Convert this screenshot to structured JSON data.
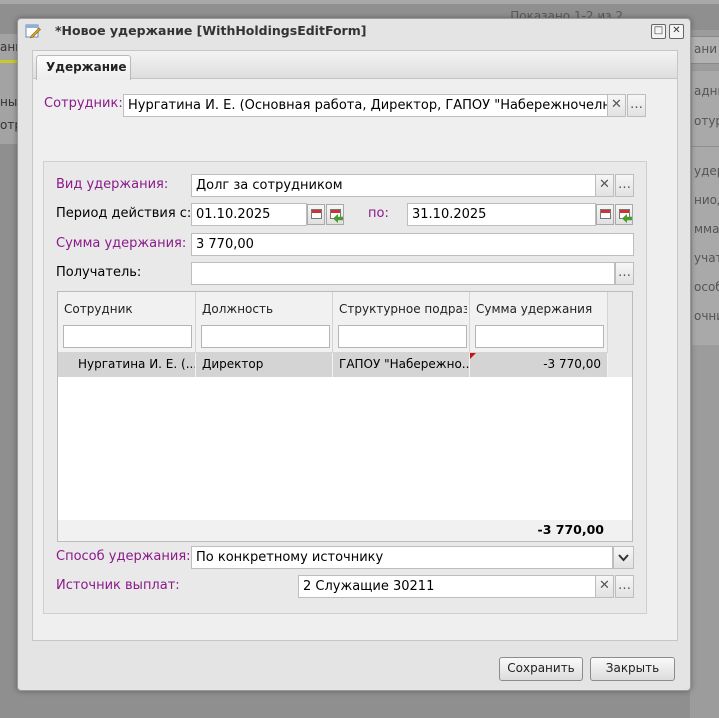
{
  "background": {
    "pager_text": "Показано 1-2 из 2",
    "left_tabs": [
      "ани",
      "ный",
      "отру"
    ],
    "right_items": [
      "адни",
      "отурн",
      "удер",
      "ниод Д",
      "мма уд",
      "учат",
      "особ у",
      "очни"
    ],
    "right_tab": "ани"
  },
  "window": {
    "title": "*Новое удержание [WithHoldingsEditForm]",
    "maximize_glyph": "□",
    "close_glyph": "✕"
  },
  "tab": {
    "label": "Удержание"
  },
  "employee": {
    "label": "Сотрудник:",
    "value": "Нургатина И. Е. (Основная работа, Директор, ГАПОУ \"Набережночелнинский"
  },
  "deduction_type": {
    "label": "Вид удержания:",
    "value": "Долг за сотрудником"
  },
  "period": {
    "label_from": "Период действия с:",
    "from": "01.10.2025",
    "label_to": "по:",
    "to": "31.10.2025"
  },
  "amount": {
    "label": "Сумма удержания:",
    "value": "3 770,00"
  },
  "recipient": {
    "label": "Получатель:",
    "value": ""
  },
  "grid": {
    "columns": [
      "Сотрудник",
      "Должность",
      "Структурное подраз...",
      "Сумма удержания"
    ],
    "rows": [
      [
        "Нургатина И. Е. (...",
        "Директор",
        "ГАПОУ \"Набережно...",
        "-3 770,00"
      ]
    ],
    "total": "-3 770,00"
  },
  "method": {
    "label": "Способ удержания:",
    "value": "По конкретному источнику"
  },
  "source": {
    "label": "Источник выплат:",
    "value": "2 Служащие 30211"
  },
  "buttons": {
    "save": "Сохранить",
    "close": "Закрыть",
    "clear": "✕",
    "more": "…",
    "dropdown": "⌄"
  },
  "colors": {
    "required_label": "#8a1a8a",
    "row_selected": "#d4d4d4",
    "total_negative": "#000000"
  }
}
